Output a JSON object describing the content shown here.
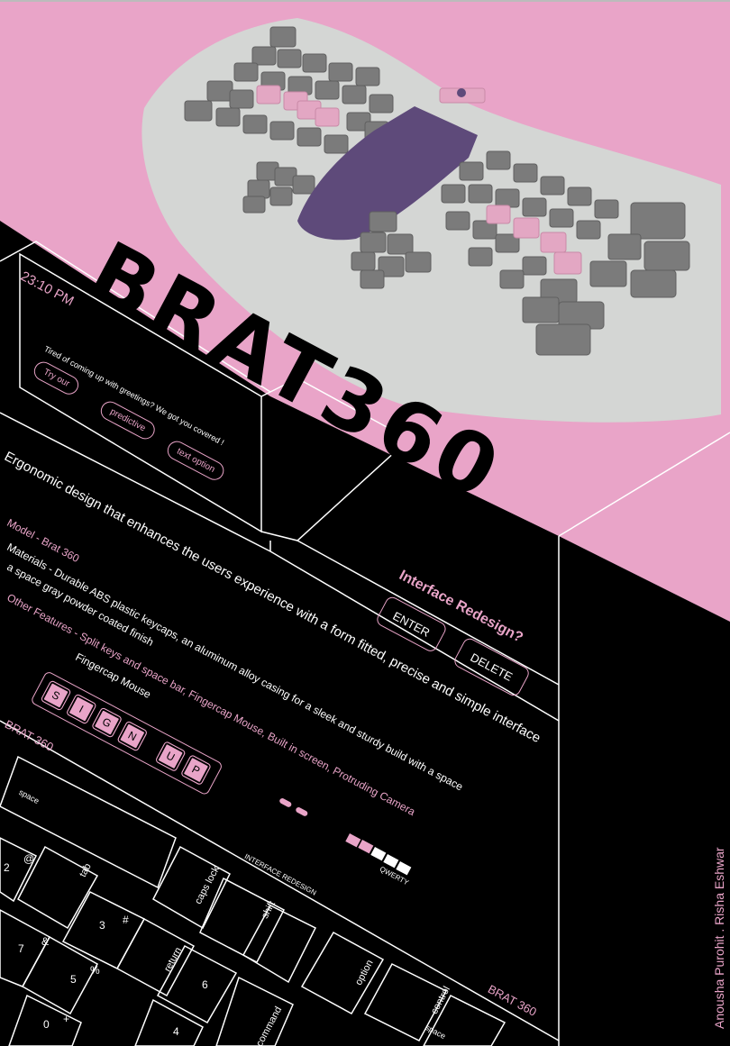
{
  "colors": {
    "pink": "#e9a4c8",
    "black": "#000000",
    "white": "#ffffff",
    "keycap_gray": "#7a7a7a",
    "palm_purple": "#5e4a7a",
    "case_gray": "#d4d6d4"
  },
  "title": "BRAT360",
  "screen": {
    "time": "23:10 PM",
    "message": "Tired of coming up with greetings? We got you covered !",
    "pills": [
      "Try our",
      "predictive",
      "text option"
    ]
  },
  "tagline": "Ergonomic design that enhances the users experience with a form fitted, precise and simple interface",
  "specs": {
    "model": "Model - Brat 360",
    "materials_line1": "Materials - Durable ABS plastic keycaps, an aluminum alloy casing for a sleek and sturdy build with a space",
    "materials_line2": "a space gray powder coated finish",
    "features_line1": "Other Features - Split keys and space bar, Fingercap Mouse,  Built in screen, Protruding Camera",
    "features_line2": "Fingercap Mouse"
  },
  "interface": {
    "heading": "Interface Redesign?",
    "enter_label": "ENTER",
    "delete_label": "DELETE"
  },
  "signup_keys": [
    "S",
    "I",
    "G",
    "N",
    "U",
    "P"
  ],
  "brand_label_top": "BRAT 360",
  "brand_label_bottom": "BRAT 360",
  "interface_redesign_label": "INTERFACE REDESIGN",
  "qwerty_label": "QWERTY",
  "keys": {
    "space_top": "space",
    "tab": "tab",
    "caps_lock": "caps lock",
    "shift": "shift",
    "return": "return",
    "option": "option",
    "control": "control",
    "command": "command",
    "space_bottom": "space",
    "num_2": "2",
    "at": "@",
    "num_3": "3",
    "hash": "#",
    "num_7": "7",
    "amp": "&",
    "num_5": "5",
    "pct": "%",
    "num_6": "6",
    "num_0": "0",
    "plus": "+",
    "num_4": "4"
  },
  "credits": "Anousha Purohit . Risha Eshwar"
}
